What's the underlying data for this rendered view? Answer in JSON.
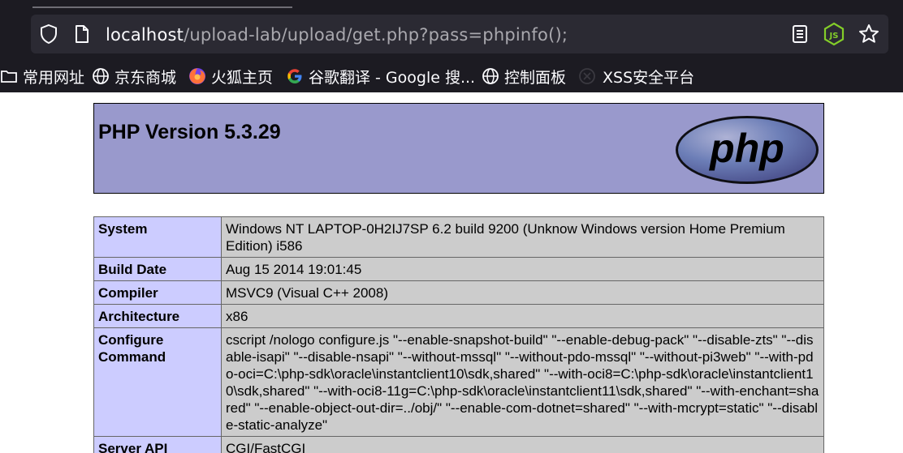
{
  "browser": {
    "url_host": "localhost",
    "url_path": "/upload-lab/upload/get.php?pass=phpinfo();",
    "icons": [
      "shield-icon",
      "page-icon",
      "reader-view-icon",
      "nodejs-extension-icon",
      "star-bookmark-icon"
    ]
  },
  "bookmarks": [
    {
      "label": "常用网址",
      "icon": "folder-icon"
    },
    {
      "label": "京东商城",
      "icon": "globe-icon"
    },
    {
      "label": "火狐主页",
      "icon": "firefox-icon"
    },
    {
      "label": "谷歌翻译 - Google 搜...",
      "icon": "google-icon"
    },
    {
      "label": "控制面板",
      "icon": "globe-icon"
    },
    {
      "label": "XSS安全平台",
      "icon": "xss-icon"
    }
  ],
  "phpinfo": {
    "title": "PHP Version 5.3.29",
    "logo_text": "php",
    "rows": [
      {
        "key": "System",
        "value": "Windows NT LAPTOP-0H2IJ7SP 6.2 build 9200 (Unknow Windows version Home Premium Edition) i586"
      },
      {
        "key": "Build Date",
        "value": "Aug 15 2014 19:01:45"
      },
      {
        "key": "Compiler",
        "value": "MSVC9 (Visual C++ 2008)"
      },
      {
        "key": "Architecture",
        "value": "x86"
      },
      {
        "key": "Configure Command",
        "value": "cscript /nologo configure.js \"--enable-snapshot-build\" \"--enable-debug-pack\" \"--disable-zts\" \"--disable-isapi\" \"--disable-nsapi\" \"--without-mssql\" \"--without-pdo-mssql\" \"--without-pi3web\" \"--with-pdo-oci=C:\\php-sdk\\oracle\\instantclient10\\sdk,shared\" \"--with-oci8=C:\\php-sdk\\oracle\\instantclient10\\sdk,shared\" \"--with-oci8-11g=C:\\php-sdk\\oracle\\instantclient11\\sdk,shared\" \"--with-enchant=shared\" \"--enable-object-out-dir=../obj/\" \"--enable-com-dotnet=shared\" \"--with-mcrypt=static\" \"--disable-static-analyze\""
      },
      {
        "key": "Server API",
        "value": "CGI/FastCGI"
      }
    ]
  },
  "colors": {
    "header_bg": "#9999cc",
    "key_bg": "#ccccff",
    "value_bg": "#cccccc",
    "toolbar_bg": "#1c1b22",
    "urlbar_bg": "#2b2a33",
    "node_green": "#83cd29"
  }
}
